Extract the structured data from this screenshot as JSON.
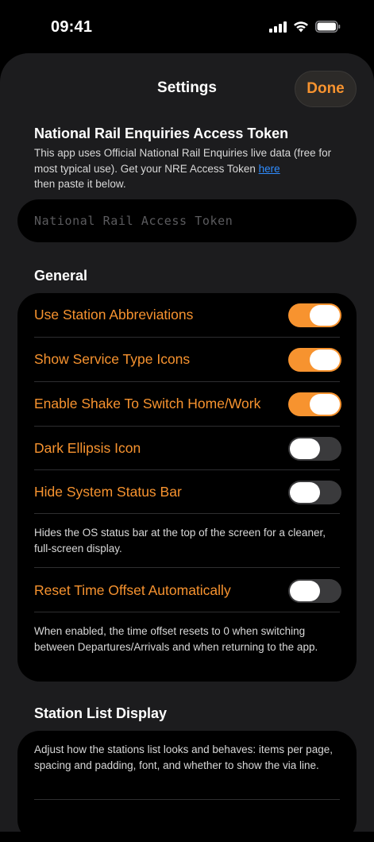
{
  "status_bar": {
    "time": "09:41"
  },
  "nav": {
    "title": "Settings",
    "done_label": "Done"
  },
  "token_section": {
    "heading": "National Rail Enquiries Access Token",
    "description_before": "This app uses Official National Rail Enquiries live data (free for most typical use). Get your NRE Access Token ",
    "link_text": "here",
    "description_after": "then paste it below.",
    "placeholder": "National Rail Access Token",
    "value": ""
  },
  "general": {
    "heading": "General",
    "toggles": [
      {
        "label": "Use Station Abbreviations",
        "on": true
      },
      {
        "label": "Show Service Type Icons",
        "on": true
      },
      {
        "label": "Enable Shake To Switch Home/Work",
        "on": true
      },
      {
        "label": "Dark Ellipsis Icon",
        "on": false
      },
      {
        "label": "Hide System Status Bar",
        "on": false
      }
    ],
    "status_bar_note": "Hides the OS status bar at the top of the screen for a cleaner, full-screen display.",
    "reset_toggle": {
      "label": "Reset Time Offset Automatically",
      "on": false
    },
    "reset_note": "When enabled, the time offset resets to 0 when switching between Departures/Arrivals and when returning to the app."
  },
  "station_list": {
    "heading": "Station List Display",
    "description": "Adjust how the stations list looks and behaves: items per page, spacing and padding, font, and whether to show the via line."
  },
  "colors": {
    "accent": "#f7932f",
    "link": "#2f8cff",
    "sheet_background": "#1c1c1e",
    "card_background": "#000000"
  }
}
